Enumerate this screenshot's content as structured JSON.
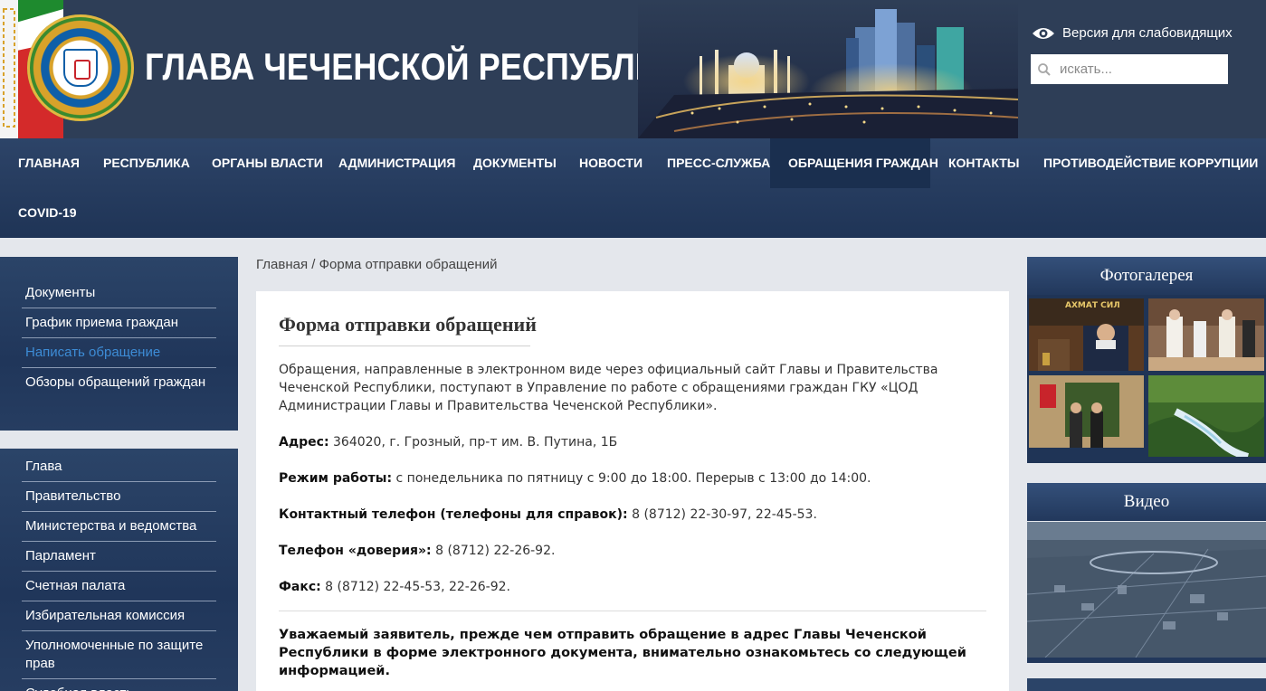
{
  "header": {
    "site_title": "ГЛАВА ЧЕЧЕНСКОЙ РЕСПУБЛИКИ",
    "vision_label": "Версия для слабовидящих",
    "search_placeholder": "искать..."
  },
  "nav": {
    "items": [
      {
        "label": "Главная"
      },
      {
        "label": "Республика"
      },
      {
        "label": "Органы власти"
      },
      {
        "label": "Администрация"
      },
      {
        "label": "Документы"
      },
      {
        "label": "Новости"
      },
      {
        "label": "Пресс-служба"
      },
      {
        "label": "Обращения граждан",
        "active": true
      },
      {
        "label": "Контакты"
      },
      {
        "label": "Противодействие коррупции"
      },
      {
        "label": "COVID-19"
      }
    ]
  },
  "sidebar_top": {
    "items": [
      {
        "label": "Документы"
      },
      {
        "label": "График приема граждан"
      },
      {
        "label": "Написать обращение",
        "current": true
      },
      {
        "label": "Обзоры обращений граждан"
      }
    ]
  },
  "sidebar_bottom": {
    "items": [
      {
        "label": "Глава"
      },
      {
        "label": "Правительство"
      },
      {
        "label": "Министерства и ведомства"
      },
      {
        "label": "Парламент"
      },
      {
        "label": "Счетная палата"
      },
      {
        "label": "Избирательная комиссия"
      },
      {
        "label": "Уполномоченные по защите прав"
      },
      {
        "label": "Судебная власть"
      }
    ]
  },
  "breadcrumb": {
    "home": "Главная",
    "separator": "/",
    "current": "Форма отправки обращений"
  },
  "content": {
    "title": "Форма отправки обращений",
    "intro": "Обращения, направленные в электронном виде через официальный сайт Главы и Правительства Чеченской Республики, поступают в  Управление по работе с обращениями граждан ГКУ «ЦОД Администрации Главы и Правительства Чеченской Республики».",
    "address_label": "Адрес:",
    "address_value": " 364020, г. Грозный, пр-т им. В. Путина, 1Б",
    "hours_label": "Режим работы:",
    "hours_value": " с понедельника по пятницу с 9:00 до 18:00. Перерыв с 13:00 до 14:00.",
    "phone_label": "Контактный телефон (телефоны для справок):",
    "phone_value": " 8 (8712) 22-30-97, 22-45-53.",
    "trust_label": "Телефон «доверия»:",
    "trust_value": " 8 (8712) 22-26-92.",
    "fax_label": "Факс:",
    "fax_value": " 8 (8712) 22-45-53, 22-26-92.",
    "notice": "Уважаемый заявитель, прежде чем отправить обращение в адрес Главы Чеченской Республики в форме электронного документа, внимательно ознакомьтесь со следующей информацией."
  },
  "right": {
    "gallery_title": "Фотогалерея",
    "video_title": "Видео"
  },
  "colors": {
    "header_bg": "#2e3e57",
    "nav_bg": "#243a5e",
    "nav_active": "#1a2f4f",
    "sidebar_current": "#3d8cd6",
    "page_bg": "#e4e7ec"
  }
}
